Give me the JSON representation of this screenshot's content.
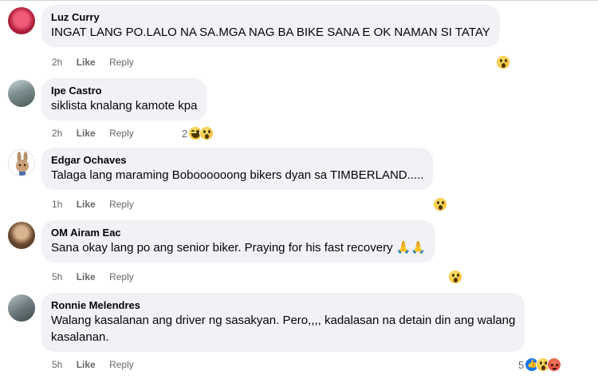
{
  "actions": {
    "like_label": "Like",
    "reply_label": "Reply"
  },
  "comments": [
    {
      "author": "Luz Curry",
      "lines": [
        "INGAT LANG PO.LALO NA SA.MGA NAG BA BIKE SANA E OK NAMAN SI TATAY"
      ],
      "time": "2h",
      "reaction_count": "",
      "reactions": [
        "wow"
      ]
    },
    {
      "author": "Ipe Castro",
      "lines": [
        "siklista knalang kamote kpa"
      ],
      "time": "2h",
      "reaction_count": "2",
      "reactions": [
        "haha",
        "wow"
      ]
    },
    {
      "author": "Edgar Ochaves",
      "lines": [
        "Talaga lang maraming Boboooooong bikers dyan sa TIMBERLAND....."
      ],
      "time": "1h",
      "reaction_count": "",
      "reactions": [
        "wow"
      ]
    },
    {
      "author": "OM Airam Eac",
      "lines": [
        "Sana okay lang po ang senior biker. Praying for his fast recovery 🙏🙏"
      ],
      "time": "5h",
      "reaction_count": "",
      "reactions": [
        "wow"
      ]
    },
    {
      "author": "Ronnie Melendres",
      "lines": [
        "Walang kasalanan ang driver ng sasakyan. Pero,,,, kadalasan na detain din ang walang",
        "kasalanan."
      ],
      "time": "5h",
      "reaction_count": "5",
      "reactions": [
        "like",
        "wow",
        "angry"
      ]
    }
  ],
  "colors": {
    "bubble_bg": "#f0f2f5",
    "meta_text": "#65676b",
    "like_blue": "#1877f2"
  }
}
